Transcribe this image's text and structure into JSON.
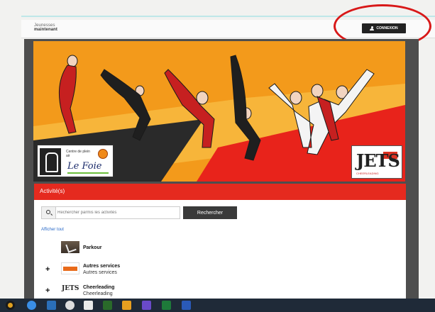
{
  "header": {
    "logo_line1": "Jeunesses",
    "logo_line2": "maintenant",
    "login_label": "CONNEXION"
  },
  "banner": {
    "centre_label_1": "Centre de plein",
    "centre_label_2": "air",
    "centre_name": "Le Foie",
    "jets_name": "JETS",
    "jets_sub": "CHEERLEADING"
  },
  "activities": {
    "title": "Activité(s)",
    "search_placeholder": "Rechercher parmis les activités",
    "search_button": "Rechercher",
    "show_all": "Afficher tout",
    "items": [
      {
        "name": "Parkour",
        "sub": "",
        "has_plus": false
      },
      {
        "name": "Autres services",
        "sub": "Autres services",
        "has_plus": true
      },
      {
        "name": "Cheerleading",
        "sub": "Cheerleading",
        "has_plus": true
      }
    ]
  },
  "colors": {
    "accent_red": "#e52a1f",
    "banner_orange": "#f39a1b",
    "annotation_circle": "#d81818"
  },
  "taskbar": {
    "icons": [
      "start-icon",
      "chrome-icon",
      "ie-icon",
      "explorer-icon",
      "settings-icon",
      "app-icon",
      "winamp-icon",
      "files-icon",
      "app2-icon",
      "excel-icon",
      "word-icon"
    ]
  }
}
